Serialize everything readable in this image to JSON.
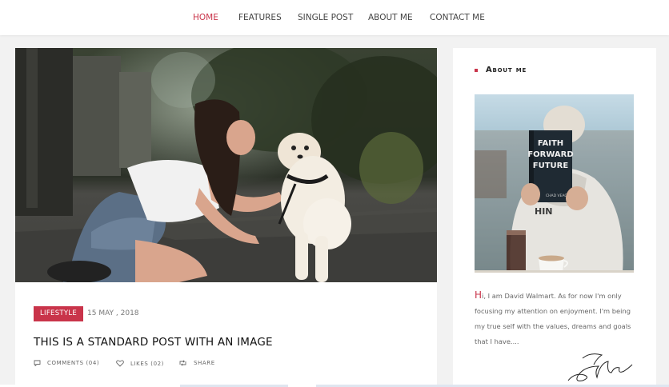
{
  "nav": {
    "items": [
      {
        "label": "HOME",
        "active": true
      },
      {
        "label": "FEATURES",
        "active": false
      },
      {
        "label": "SINGLE POST",
        "active": false
      },
      {
        "label": "ABOUT ME",
        "active": false
      },
      {
        "label": "CONTACT ME",
        "active": false
      }
    ]
  },
  "post": {
    "category": "LIFESTYLE",
    "date": "15 MAY , 2018",
    "title": "THIS IS A STANDARD POST WITH AN IMAGE",
    "meta": {
      "comments": "COMMENTS (04)",
      "likes": "LIKES (02)",
      "share": "SHARE"
    }
  },
  "sidebar": {
    "about": {
      "title": "About me",
      "drop_letter": "H",
      "text": "i, I am David Walmart. As for now I'm only focusing my attention on enjoyment. I'm being my true self with the values, dreams and goals that I have....",
      "book": {
        "line1": "FAITH",
        "line2": "FORWARD",
        "line3": "FUTURE",
        "author": "CHAD VEACH",
        "mug_text": "HIN"
      }
    }
  },
  "icons": {
    "comments": "comment-icon",
    "likes": "heart-icon",
    "share": "retweet-icon"
  },
  "colors": {
    "accent": "#c9344a",
    "background": "#f2f2f2",
    "card": "#ffffff"
  }
}
